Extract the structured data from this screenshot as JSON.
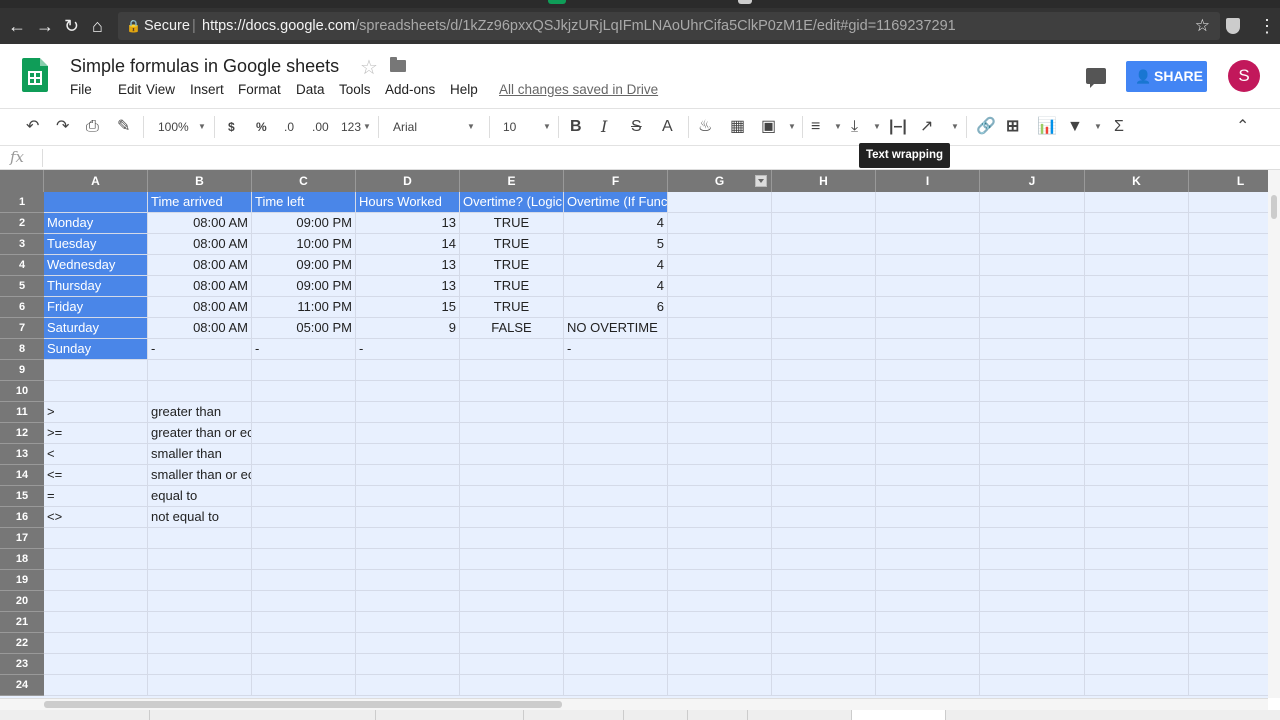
{
  "browser": {
    "secure_label": "Secure",
    "url_host": "https://docs.google.com",
    "url_path": "/spreadsheets/d/1kZz96pxxQSJkjzURjLqIFmLNAoUhrCifa5ClkP0zM1E/edit#gid=1169237291"
  },
  "doc": {
    "title": "Simple formulas in Google sheets",
    "saved_status": "All changes saved in Drive",
    "share_label": "SHARE",
    "avatar_letter": "S"
  },
  "menu": [
    "File",
    "Edit",
    "View",
    "Insert",
    "Format",
    "Data",
    "Tools",
    "Add-ons",
    "Help"
  ],
  "toolbar": {
    "zoom": "100%",
    "currency": "$",
    "percent": "%",
    "decrease_decimal": ".0",
    "increase_decimal": ".00",
    "more_formats": "123",
    "font": "Arial",
    "font_size": "10",
    "bold": "B",
    "italic": "I",
    "strikethrough": "S",
    "text_color": "A",
    "tooltip": "Text wrapping"
  },
  "formula_bar": {
    "fx": "fx"
  },
  "columns": [
    "A",
    "B",
    "C",
    "D",
    "E",
    "F",
    "G",
    "H",
    "I",
    "J",
    "K",
    "L"
  ],
  "rows": [
    "1",
    "2",
    "3",
    "4",
    "5",
    "6",
    "7",
    "8",
    "9",
    "10",
    "11",
    "12",
    "13",
    "14",
    "15",
    "16",
    "17",
    "18",
    "19",
    "20",
    "21",
    "22",
    "23",
    "24"
  ],
  "cells": {
    "r1": [
      "",
      "Time arrived",
      "Time left",
      "Hours Worked",
      "Overtime? (Logic",
      "Overtime (If Func"
    ],
    "r2": [
      "Monday",
      "08:00 AM",
      "09:00 PM",
      "13",
      "TRUE",
      "4"
    ],
    "r3": [
      "Tuesday",
      "08:00 AM",
      "10:00 PM",
      "14",
      "TRUE",
      "5"
    ],
    "r4": [
      "Wednesday",
      "08:00 AM",
      "09:00 PM",
      "13",
      "TRUE",
      "4"
    ],
    "r5": [
      "Thursday",
      "08:00 AM",
      "09:00 PM",
      "13",
      "TRUE",
      "4"
    ],
    "r6": [
      "Friday",
      "08:00 AM",
      "11:00 PM",
      "15",
      "TRUE",
      "6"
    ],
    "r7": [
      "Saturday",
      "08:00 AM",
      "05:00 PM",
      "9",
      "FALSE",
      "NO OVERTIME"
    ],
    "r8": [
      "Sunday",
      "-",
      "-",
      "-",
      "",
      "-"
    ],
    "r11": [
      ">",
      "greater than"
    ],
    "r12": [
      ">=",
      "greater than or ec"
    ],
    "r13": [
      "<",
      "smaller than"
    ],
    "r14": [
      "<=",
      "smaller than or ec"
    ],
    "r15": [
      " =",
      "equal to"
    ],
    "r16": [
      "<>",
      "not equal to"
    ]
  },
  "colors": {
    "header_fill": "#4a86e8",
    "selection_fill": "#e8f0fe",
    "share": "#4285f4",
    "avatar": "#c2185b",
    "sheets_green": "#0f9d58"
  }
}
